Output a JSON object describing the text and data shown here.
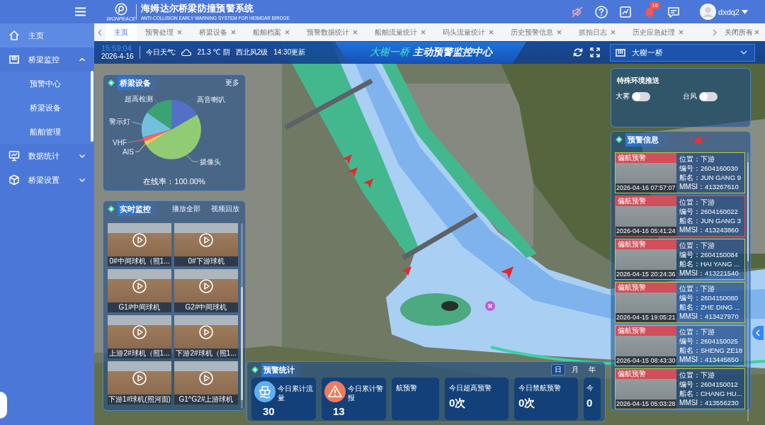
{
  "sidebar": {
    "items": [
      {
        "label": "主页",
        "selected": true
      },
      {
        "label": "桥梁监控",
        "selected": false,
        "expanded": true,
        "children": [
          {
            "label": "预警中心",
            "selected": false
          },
          {
            "label": "桥梁设备",
            "selected": false
          },
          {
            "label": "船舶管理",
            "selected": false
          }
        ]
      },
      {
        "label": "数据统计",
        "selected": false,
        "expanded": false
      },
      {
        "label": "桥梁设置",
        "selected": false,
        "expanded": false
      }
    ]
  },
  "header": {
    "logo_text": "WONPEACE",
    "title": "海姆达尔桥梁防撞预警系统",
    "subtitle": "ANTI-COLLISION EARLY WARNING SYSTEM FOR HEIMDAR BRIDGE",
    "notification_count": "16",
    "username": "dxdq2"
  },
  "tabs": {
    "items": [
      {
        "label": "主页",
        "selected": true,
        "closable": false
      },
      {
        "label": "预警处理",
        "selected": false,
        "closable": true
      },
      {
        "label": "桥梁设备",
        "selected": false,
        "closable": true
      },
      {
        "label": "船舶档案",
        "selected": false,
        "closable": true
      },
      {
        "label": "预警数据统计",
        "selected": false,
        "closable": true
      },
      {
        "label": "船舶流量统计",
        "selected": false,
        "closable": true
      },
      {
        "label": "码头流量统计",
        "selected": false,
        "closable": true
      },
      {
        "label": "历史预警信息",
        "selected": false,
        "closable": true
      },
      {
        "label": "抓拍日志",
        "selected": false,
        "closable": true
      },
      {
        "label": "历史应急处理",
        "selected": false,
        "closable": true
      }
    ],
    "close_all": "关闭所有"
  },
  "info_bar": {
    "time": "15:59:04",
    "date": "2026-4-16",
    "weather_label": "今日天气:",
    "weather": "21.3 ℃ 阴",
    "wind": "西北风2级",
    "updated": "14:30更新"
  },
  "center_title": {
    "bridge": "大榭一桥",
    "text": "主动预警监控中心"
  },
  "bridge_select": {
    "value": "大榭一桥"
  },
  "equipment": {
    "title": "桥梁设备",
    "more": "更多",
    "segments": [
      {
        "label": "超高检测",
        "color": "#3ba272"
      },
      {
        "label": "高音喇叭",
        "color": "#5470c6"
      },
      {
        "label": "警示灯",
        "color": "#73c0de"
      },
      {
        "label": "VHF",
        "color": "#ee6666"
      },
      {
        "label": "AIS",
        "color": "#fac858"
      },
      {
        "label": "摄像头",
        "color": "#91cc75"
      }
    ],
    "online_rate": "在线率：100.00%"
  },
  "monitoring": {
    "title": "实时监控",
    "play_all": "播放全部",
    "playback": "视频回放",
    "cameras": [
      {
        "label": "0#中间球机（照1..."
      },
      {
        "label": "0#下游球机"
      },
      {
        "label": "G1#中间球机"
      },
      {
        "label": "G2#中间球机"
      },
      {
        "label": "上游2#球机（照1..."
      },
      {
        "label": "下游2#球机（照1..."
      },
      {
        "label": "下游1#球机(照河面)"
      },
      {
        "label": "G1^G2#上游球机"
      }
    ]
  },
  "special_push": {
    "title": "特殊环境推送",
    "switches": [
      {
        "label": "大雾",
        "on": false
      },
      {
        "label": "台风",
        "on": false
      }
    ]
  },
  "warnings": {
    "title": "预警信息",
    "items": [
      {
        "tag": "偏航预警",
        "time": "2026-04-16 07:57:07",
        "selected": false,
        "fields": [
          {
            "label": "位置：",
            "value": "下游"
          },
          {
            "label": "编号：",
            "value": "2604160030"
          },
          {
            "label": "船名：",
            "value": "JUN GANG 9"
          },
          {
            "label": "MMSI：",
            "value": "413267610"
          }
        ]
      },
      {
        "tag": "偏航预警",
        "time": "2026-04-16 05:41:24",
        "selected": true,
        "fields": [
          {
            "label": "位置：",
            "value": "下游"
          },
          {
            "label": "编号：",
            "value": "2604160022"
          },
          {
            "label": "船名：",
            "value": "JUN GANG 3"
          },
          {
            "label": "MMSI：",
            "value": "413243860"
          }
        ]
      },
      {
        "tag": "偏航预警",
        "time": "2026-04-15 20:24:36",
        "selected": false,
        "fields": [
          {
            "label": "位置：",
            "value": "下游"
          },
          {
            "label": "编号：",
            "value": "2604150084"
          },
          {
            "label": "船名：",
            "value": "HAI YANG ..."
          },
          {
            "label": "MMSI：",
            "value": "413221540"
          }
        ]
      },
      {
        "tag": "偏航预警",
        "time": "2026-04-15 19:05:21",
        "selected": false,
        "fields": [
          {
            "label": "位置：",
            "value": "下游"
          },
          {
            "label": "编号：",
            "value": "2604150080"
          },
          {
            "label": "船名：",
            "value": "ZHE DING ..."
          },
          {
            "label": "MMSI：",
            "value": "413427970"
          }
        ]
      },
      {
        "tag": "偏航预警",
        "time": "2026-04-15 08:43:30",
        "selected": false,
        "fields": [
          {
            "label": "位置：",
            "value": "下游"
          },
          {
            "label": "编号：",
            "value": "2604150025"
          },
          {
            "label": "船名：",
            "value": "SHENG ZE18"
          },
          {
            "label": "MMSI：",
            "value": "413445650"
          }
        ]
      },
      {
        "tag": "偏航预警",
        "time": "2026-04-15 05:03:28",
        "selected": false,
        "fields": [
          {
            "label": "位置：",
            "value": "下游"
          },
          {
            "label": "编号：",
            "value": "2604150012"
          },
          {
            "label": "船名：",
            "value": "CHANG HU..."
          },
          {
            "label": "MMSI：",
            "value": "413556230"
          }
        ]
      }
    ]
  },
  "stats": {
    "title": "预警统计",
    "periods": [
      {
        "label": "日",
        "selected": true
      },
      {
        "label": "月",
        "selected": false
      },
      {
        "label": "年",
        "selected": false
      }
    ],
    "cards": [
      {
        "kind": "flow",
        "label": "今日累计流量",
        "value": "30",
        "color": "#62aef0"
      },
      {
        "kind": "alert",
        "label": "今日累计警报",
        "value": "13",
        "color": "#f07c5e"
      },
      {
        "kind": "count",
        "label": "航预警"
      },
      {
        "kind": "count",
        "label": "今日超高预警",
        "value": "0次"
      },
      {
        "kind": "count",
        "label": "今日禁航预警",
        "value": "0次"
      },
      {
        "kind": "count",
        "label": "今",
        "value": "0"
      }
    ]
  }
}
